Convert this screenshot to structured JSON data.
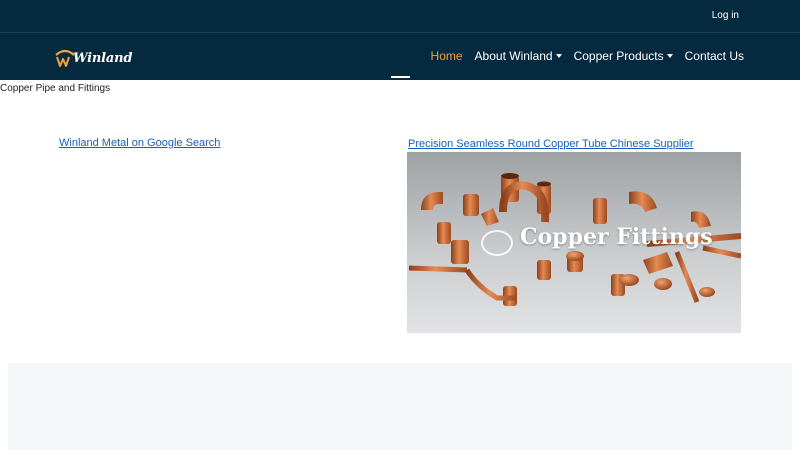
{
  "topbar": {
    "login_label": "Log in"
  },
  "brand": {
    "name": "Winland"
  },
  "nav": {
    "home": "Home",
    "about": "About Winland",
    "products": "Copper Products",
    "contact": "Contact Us"
  },
  "page": {
    "heading": "Copper Pipe and Fittings",
    "google_link": "Winland Metal on Google Search",
    "supplier_link": "Precision Seamless Round Copper Tube Chinese Supplier",
    "banner_caption": "Copper Fittings"
  },
  "colors": {
    "header_bg": "#052a3f",
    "active_nav": "#f2a33a",
    "link": "#1a5fb4",
    "copper": "#c8693a"
  }
}
